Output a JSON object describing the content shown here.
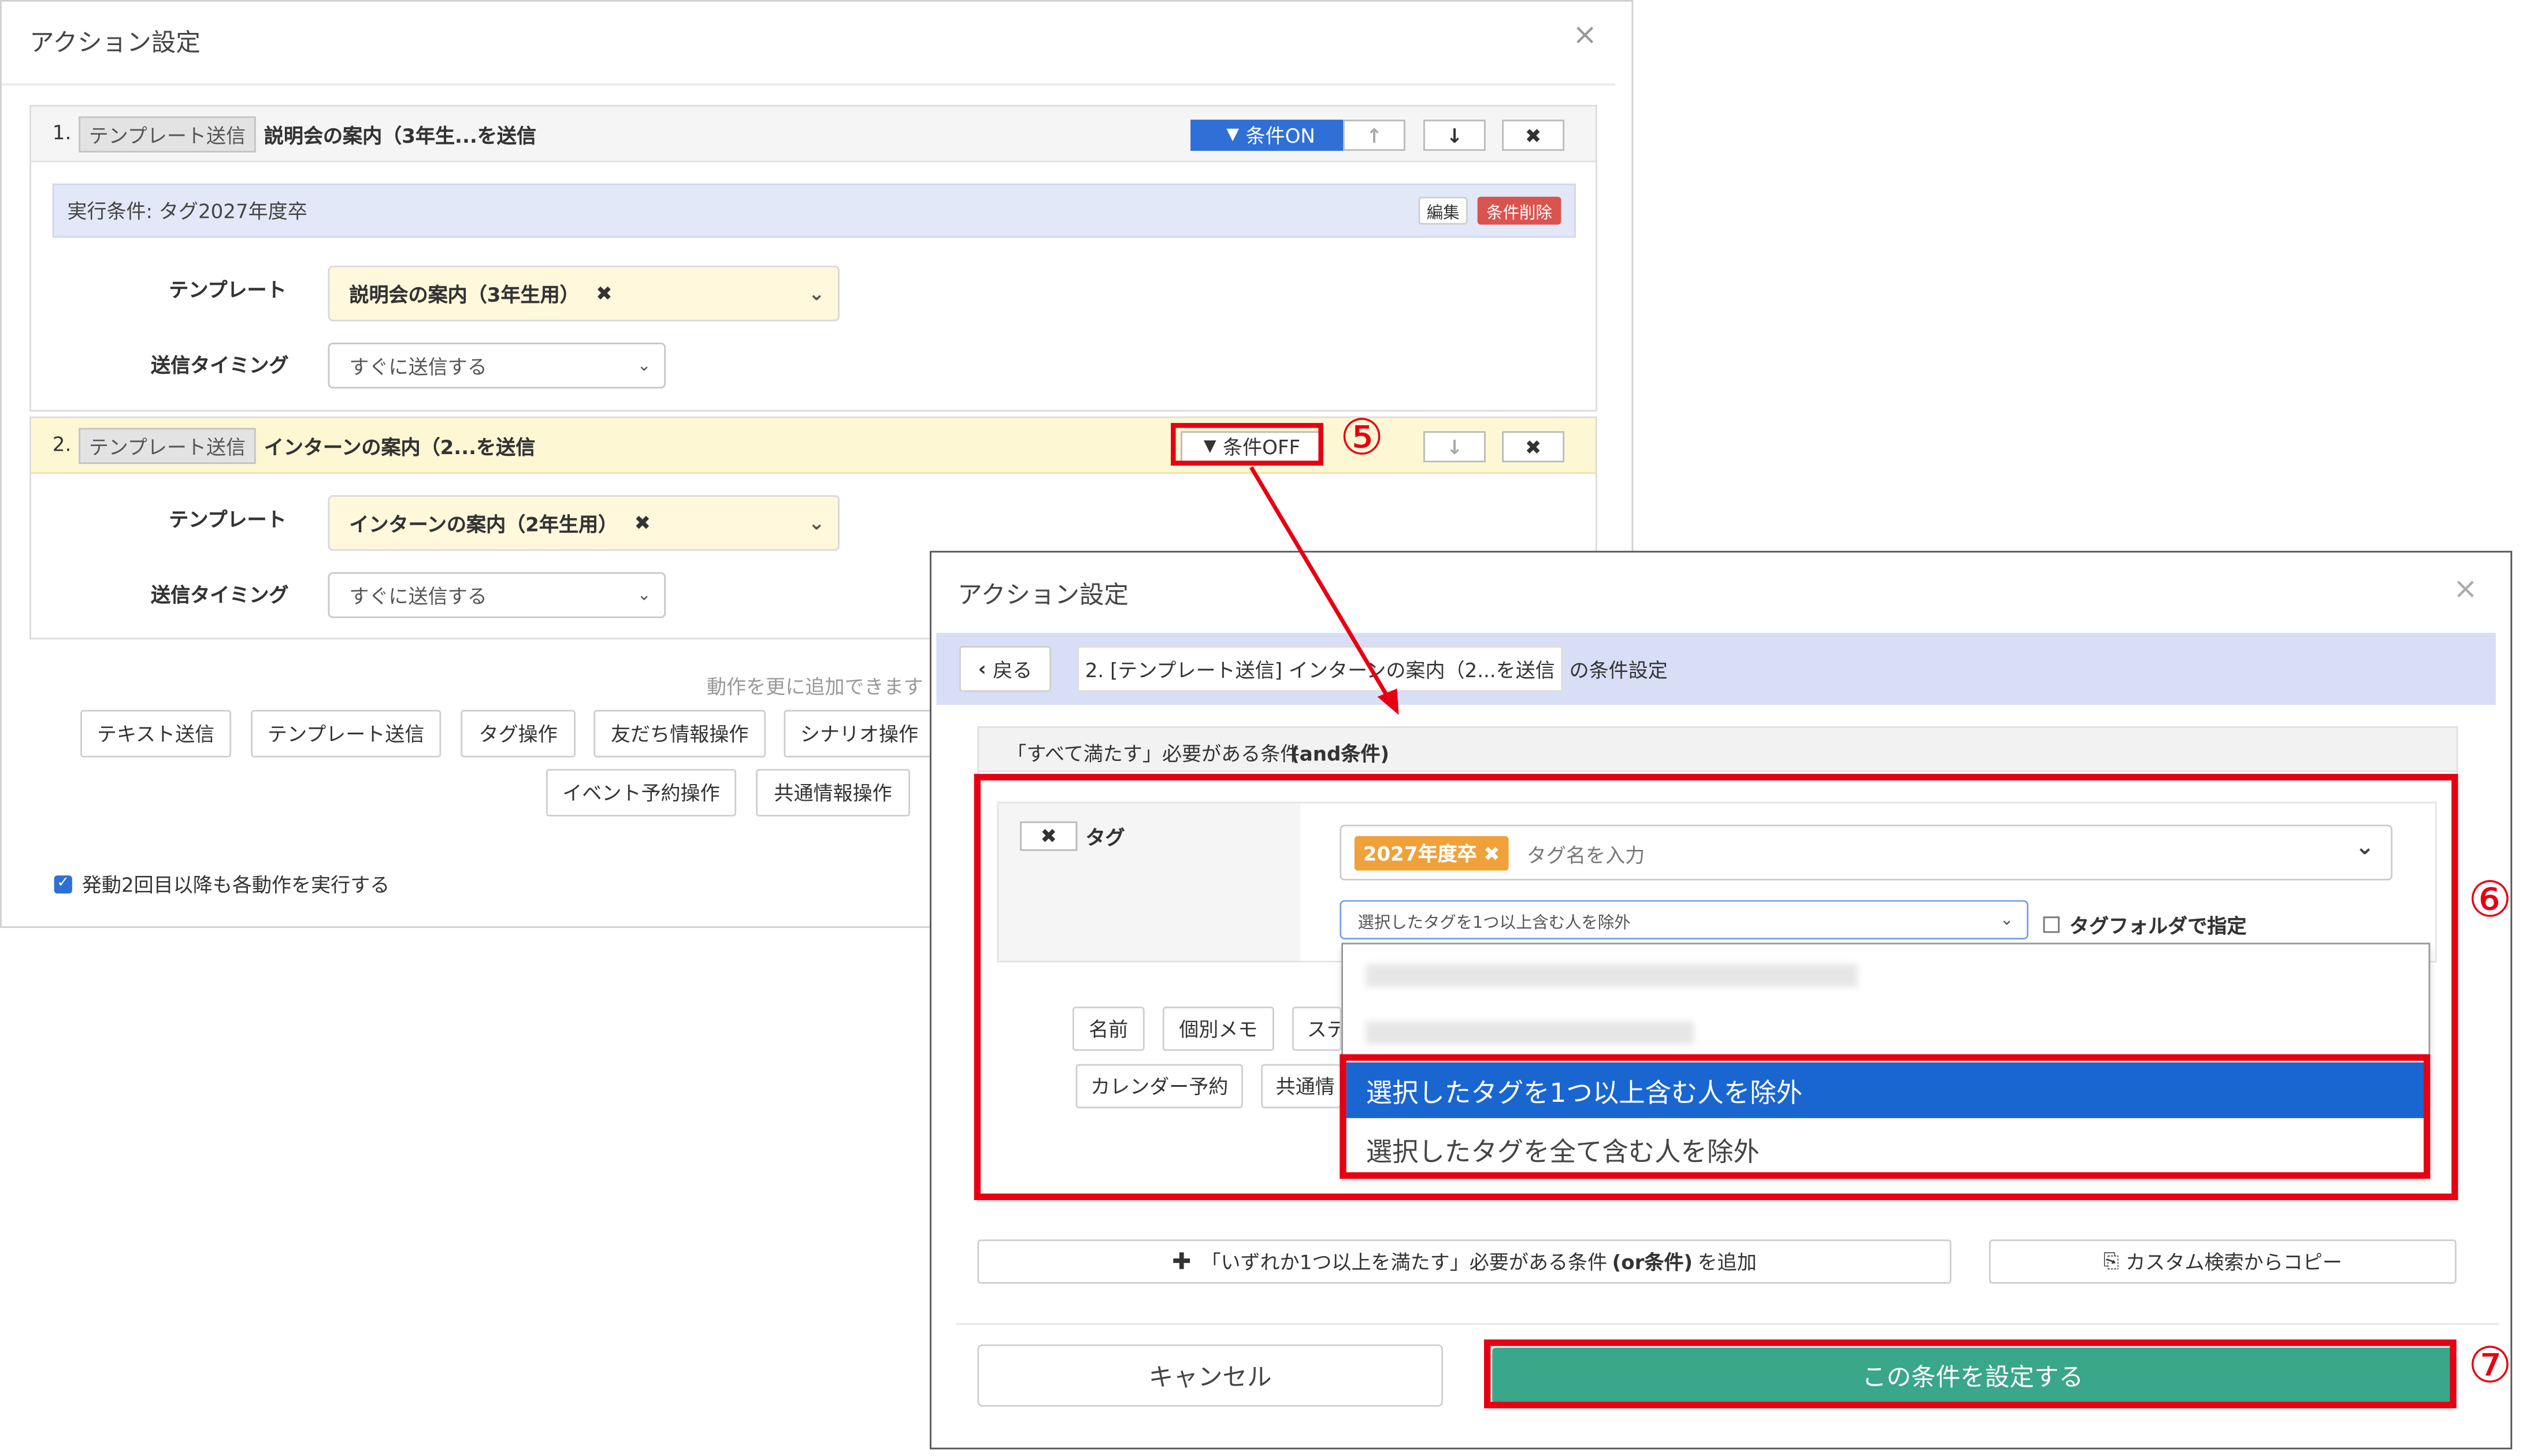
{
  "dialog1": {
    "title": "アクション設定",
    "close": "×",
    "action1": {
      "num": "1.",
      "type": "テンプレート送信",
      "name": "説明会の案内（3年生...を送信",
      "cond_btn": "条件ON",
      "up": "↑",
      "down": "↓",
      "del": "✖",
      "condition_text": "実行条件: タグ2027年度卒",
      "edit": "編集",
      "delete_condition": "条件削除",
      "template_label": "テンプレート",
      "template_value": "説明会の案内（3年生用）",
      "timing_label": "送信タイミング",
      "timing_value": "すぐに送信する"
    },
    "action2": {
      "num": "2.",
      "type": "テンプレート送信",
      "name": "インターンの案内（2...を送信",
      "cond_btn": "条件OFF",
      "down": "↓",
      "del": "✖",
      "template_label": "テンプレート",
      "template_value": "インターンの案内（2年生用）",
      "timing_label": "送信タイミング",
      "timing_value": "すぐに送信する"
    },
    "add_hint": "動作を更に追加できます",
    "add_buttons_row1": [
      "テキスト送信",
      "テンプレート送信",
      "タグ操作",
      "友だち情報操作",
      "シナリオ操作"
    ],
    "add_buttons_row2": [
      "イベント予約操作",
      "共通情報操作"
    ],
    "checkbox_label": "発動2回目以降も各動作を実行する"
  },
  "dialog2": {
    "title": "アクション設定",
    "close": "×",
    "back": "戻る",
    "crumb": "2. [テンプレート送信] インターンの案内（2...を送信",
    "crumb_suffix": "の条件設定",
    "group_title": "「すべて満たす」必要がある条件",
    "group_title_bold": "(and条件)",
    "tag_label": "タグ",
    "tag_chip": "2027年度卒",
    "tag_placeholder": "タグ名を入力",
    "mode_value": "選択したタグを1つ以上含む人を除外",
    "folder_label": "タグフォルダで指定",
    "dropdown_options": [
      "選択したタグを1つ以上含む人を除外",
      "選択したタグを全て含む人を除外"
    ],
    "field_buttons_row1": [
      "名前",
      "個別メモ",
      "ステ"
    ],
    "field_buttons_row2": [
      "カレンダー予約",
      "共通情"
    ],
    "or_button": "「いずれか1つ以上を満たす」必要がある条件",
    "or_button_bold": "(or条件)",
    "or_button_suffix": "を追加",
    "copy_button": "カスタム検索からコピー",
    "cancel": "キャンセル",
    "submit": "この条件を設定する"
  },
  "annotations": {
    "step5": "⑤",
    "step6": "⑥",
    "step7": "⑦"
  },
  "colors": {
    "accent_blue": "#2f6fd6",
    "danger_red": "#d9534f",
    "teal": "#3aa68a",
    "annotation_red": "#e60012",
    "highlight_option": "#1a66d1"
  }
}
